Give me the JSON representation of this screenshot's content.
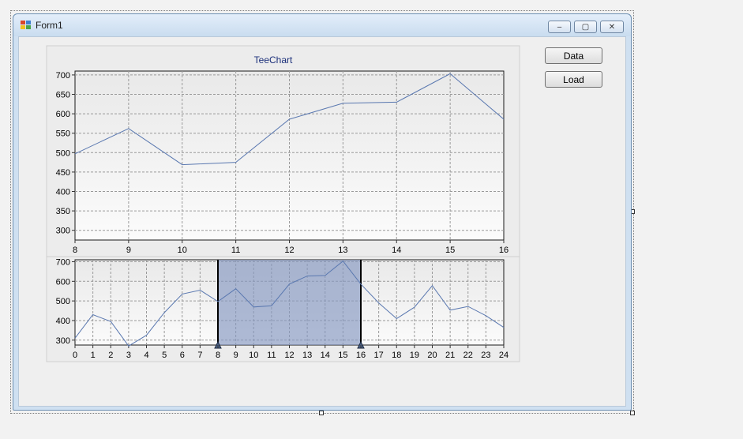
{
  "window": {
    "title": "Form1",
    "minimize_glyph": "‒",
    "maximize_glyph": "▢",
    "close_glyph": "✕"
  },
  "buttons": {
    "data_label": "Data",
    "load_label": "Load"
  },
  "colors": {
    "series_line": "#5a78b0",
    "selection_fill": "#8496c0",
    "selection_border": "#000000",
    "title_text": "#1b2f7a"
  },
  "chart_data": [
    {
      "type": "line",
      "title": "TeeChart",
      "x": [
        8,
        9,
        10,
        11,
        12,
        13,
        14,
        15,
        16
      ],
      "series": [
        {
          "values": [
            497,
            562,
            469,
            475,
            586,
            627,
            630,
            703,
            586
          ]
        }
      ],
      "xlim": [
        8,
        16
      ],
      "ylim": [
        275,
        710
      ],
      "xticks": [
        8,
        9,
        10,
        11,
        12,
        13,
        14,
        15,
        16
      ],
      "yticks": [
        300,
        350,
        400,
        450,
        500,
        550,
        600,
        650,
        700
      ],
      "grid": true,
      "legend": "none"
    },
    {
      "type": "line",
      "title": "",
      "x": [
        0,
        1,
        2,
        3,
        4,
        5,
        6,
        7,
        8,
        9,
        10,
        11,
        12,
        13,
        14,
        15,
        16,
        17,
        18,
        19,
        20,
        21,
        22,
        23,
        24
      ],
      "series": [
        {
          "values": [
            310,
            430,
            395,
            270,
            325,
            440,
            535,
            555,
            497,
            562,
            469,
            475,
            586,
            627,
            630,
            703,
            586,
            490,
            410,
            468,
            578,
            453,
            472,
            425,
            365
          ]
        }
      ],
      "xlim": [
        0,
        24
      ],
      "ylim": [
        275,
        710
      ],
      "xticks": [
        0,
        1,
        2,
        3,
        4,
        5,
        6,
        7,
        8,
        9,
        10,
        11,
        12,
        13,
        14,
        15,
        16,
        17,
        18,
        19,
        20,
        21,
        22,
        23,
        24
      ],
      "yticks": [
        300,
        400,
        500,
        600,
        700
      ],
      "grid": true,
      "legend": "none",
      "selection_range": [
        8,
        16
      ]
    }
  ]
}
